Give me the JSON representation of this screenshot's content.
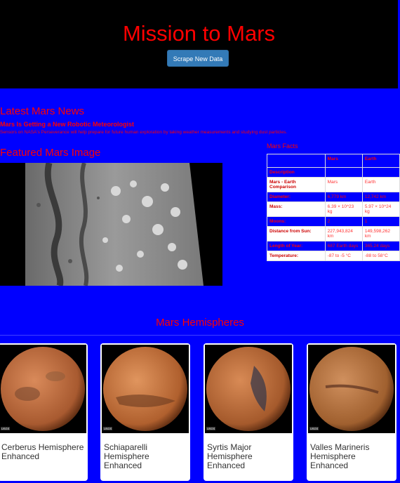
{
  "header": {
    "title": "Mission to Mars",
    "scrape_button": "Scrape New Data"
  },
  "news": {
    "heading": "Latest Mars News",
    "title": "Mars Is Getting a New Robotic Meteorologist",
    "paragraph": "Sensors on NASA's Perseverance will help prepare for future human exploration by taking weather measurements and studying dust particles."
  },
  "featured": {
    "heading": "Featured Mars Image"
  },
  "facts": {
    "heading": "Mars Facts",
    "columns": [
      "",
      "Mars",
      "Earth"
    ],
    "rows": [
      {
        "label": "Description",
        "mars": "",
        "earth": ""
      },
      {
        "label": "Mars - Earth Comparison",
        "mars": "Mars",
        "earth": "Earth"
      },
      {
        "label": "Diameter:",
        "mars": "6,779 km",
        "earth": "12,742 km"
      },
      {
        "label": "Mass:",
        "mars": "6.39 × 10^23 kg",
        "earth": "5.97 × 10^24 kg"
      },
      {
        "label": "Moons:",
        "mars": "2",
        "earth": "1"
      },
      {
        "label": "Distance from Sun:",
        "mars": "227,943,824 km",
        "earth": "149,598,262 km"
      },
      {
        "label": "Length of Year:",
        "mars": "687 Earth days",
        "earth": "365.24 days"
      },
      {
        "label": "Temperature:",
        "mars": "-87 to -5 °C",
        "earth": "-88 to 58°C"
      }
    ]
  },
  "hemispheres": {
    "heading": "Mars Hemispheres",
    "cards": [
      {
        "title": "Cerberus Hemisphere Enhanced",
        "icon": "mars-cerberus-image"
      },
      {
        "title": "Schiaparelli Hemisphere Enhanced",
        "icon": "mars-schiaparelli-image"
      },
      {
        "title": "Syrtis Major Hemisphere Enhanced",
        "icon": "mars-syrtis-image"
      },
      {
        "title": "Valles Marineris Hemisphere Enhanced",
        "icon": "mars-valles-image"
      }
    ]
  },
  "colors": {
    "page_bg": "#0000ff",
    "accent_text": "#ff0000",
    "button": "#337ab7"
  }
}
